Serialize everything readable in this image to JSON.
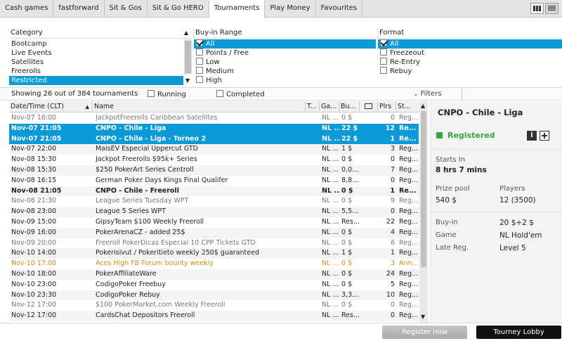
{
  "tabs": [
    {
      "label": "Cash games",
      "active": false
    },
    {
      "label": "fastforward",
      "active": false
    },
    {
      "label": "Sit & Gos",
      "active": false
    },
    {
      "label": "Sit & Go HERO",
      "active": false
    },
    {
      "label": "Tournaments",
      "active": true
    },
    {
      "label": "Play Money",
      "active": false
    },
    {
      "label": "Favourites",
      "active": false
    }
  ],
  "filters": {
    "category": {
      "header": "Category",
      "items": [
        "Bootcamp",
        "Live Events",
        "Satellites",
        "Freerolls",
        "Restricted"
      ],
      "selected_index": 4
    },
    "buyin": {
      "header": "Buy-in Range",
      "items": [
        {
          "label": "All",
          "checked": true
        },
        {
          "label": "Points / Free",
          "checked": false
        },
        {
          "label": "Low",
          "checked": false
        },
        {
          "label": "Medium",
          "checked": false
        },
        {
          "label": "High",
          "checked": false
        }
      ]
    },
    "format": {
      "header": "Format",
      "items": [
        {
          "label": "All",
          "checked": true
        },
        {
          "label": "Freezeout",
          "checked": false
        },
        {
          "label": "Re-Entry",
          "checked": false
        },
        {
          "label": "Rebuy",
          "checked": false
        }
      ]
    }
  },
  "showbar": {
    "showing": "Showing 26 out of 384 tournaments",
    "running": "Running",
    "completed": "Completed",
    "filters": "Filters"
  },
  "table": {
    "headers": [
      "Date/Time (CLT)",
      "Name",
      "T...",
      "Ga...",
      "Bu...",
      "",
      "Plrs",
      "St..."
    ],
    "rows": [
      {
        "date": "Nov-07 16:00",
        "name": "JackpotFreerolls Caribbean Satellites",
        "game": "NL ...",
        "buyin": "0 $",
        "plrs": "0",
        "status": "Reg...",
        "style": "gray"
      },
      {
        "date": "Nov-07 21:05",
        "name": "CNPO - Chile - Liga",
        "game": "NL ...",
        "buyin": "22 $",
        "plrs": "12",
        "status": "Re...",
        "style": "sel"
      },
      {
        "date": "Nov-07 21:05",
        "name": "CNPO - Chile - Liga - Torneo 2",
        "game": "NL ...",
        "buyin": "22 $",
        "plrs": "1",
        "status": "Re...",
        "style": "sel"
      },
      {
        "date": "Nov-07 22:00",
        "name": "MaisEV Especial Uppercut GTD",
        "game": "NL ...",
        "buyin": "1 $",
        "plrs": "3",
        "status": "Reg...",
        "style": ""
      },
      {
        "date": "Nov-08 15:30",
        "name": "Jackpot Freerolls $95k+ Series",
        "game": "NL ...",
        "buyin": "0 $",
        "plrs": "0",
        "status": "Reg...",
        "style": ""
      },
      {
        "date": "Nov-08 15:30",
        "name": "$250 PokerArt Series Centroll",
        "game": "NL ...",
        "buyin": "0,0...",
        "plrs": "7",
        "status": "Reg...",
        "style": ""
      },
      {
        "date": "Nov-08 16:15",
        "name": "German Poker Days Kings Final Qualifer",
        "game": "NL ...",
        "buyin": "8,8...",
        "plrs": "0",
        "status": "Reg...",
        "style": ""
      },
      {
        "date": "Nov-08 21:05",
        "name": "CNPO - Chile - Freeroll",
        "game": "NL ...",
        "buyin": "0 $",
        "plrs": "1",
        "status": "Re...",
        "style": "bold"
      },
      {
        "date": "Nov-08 21:30",
        "name": "League Series Tuesday WPT",
        "game": "NL ...",
        "buyin": "0 $",
        "plrs": "9",
        "status": "Reg...",
        "style": "gray"
      },
      {
        "date": "Nov-08 23:00",
        "name": "League 5 Series WPT",
        "game": "NL ...",
        "buyin": "5,5...",
        "plrs": "0",
        "status": "Reg...",
        "style": ""
      },
      {
        "date": "Nov-09 15:00",
        "name": "GipsyTeam $100 Weekly Freeroll",
        "game": "NL ...",
        "buyin": "Res...",
        "plrs": "22",
        "status": "Reg...",
        "style": ""
      },
      {
        "date": "Nov-09 16:00",
        "name": "PokerArenaCZ - added 25$",
        "game": "NL ...",
        "buyin": "0 $",
        "plrs": "4",
        "status": "Reg...",
        "style": ""
      },
      {
        "date": "Nov-09 20:00",
        "name": "Freeroll PokerDicas Especial 10 CPP Tickets GTD",
        "game": "NL ...",
        "buyin": "0 $",
        "plrs": "6",
        "status": "Reg...",
        "style": "gray"
      },
      {
        "date": "Nov-10 14:00",
        "name": "Pokerisivut / Pokeritieto weekly 250$ guaranteed",
        "game": "NL ...",
        "buyin": "1 $",
        "plrs": "1",
        "status": "Reg...",
        "style": ""
      },
      {
        "date": "Nov-10 17:00",
        "name": "Aces High FB Forum bounty weekly",
        "game": "NL ...",
        "buyin": "0 $",
        "plrs": "3",
        "status": "Ann...",
        "style": "orange"
      },
      {
        "date": "Nov-10 18:00",
        "name": "PokerAffiliateWare",
        "game": "NL ...",
        "buyin": "0 $",
        "plrs": "24",
        "status": "Reg...",
        "style": ""
      },
      {
        "date": "Nov-10 23:00",
        "name": "CodigoPoker Freebuy",
        "game": "NL ...",
        "buyin": "0 $",
        "plrs": "5",
        "status": "Reg...",
        "style": ""
      },
      {
        "date": "Nov-10 23:30",
        "name": "CodigoPoker Rebuy",
        "game": "NL ...",
        "buyin": "3,3...",
        "plrs": "10",
        "status": "Reg...",
        "style": ""
      },
      {
        "date": "Nov-12 17:00",
        "name": "$100 PokerMarket.com Weekly Freeroll",
        "game": "NL ...",
        "buyin": "0 $",
        "plrs": "0",
        "status": "Reg...",
        "style": "gray"
      },
      {
        "date": "Nov-12 17:00",
        "name": "CardsChat Depositors Freeroll",
        "game": "NL ...",
        "buyin": "Res...",
        "plrs": "0",
        "status": "Reg...",
        "style": ""
      }
    ]
  },
  "detail": {
    "title": "CNPO - Chile - Liga",
    "status": "Registered",
    "starts_in_label": "Starts In",
    "starts_in_value": "8 hrs  7 mins",
    "prize_pool_label": "Prize pool",
    "prize_pool_value": "540 $",
    "players_label": "Players",
    "players_value": "12 (3500)",
    "buyin_label": "Buy-in",
    "buyin_value": "20 $+2 $",
    "game_label": "Game",
    "game_value": "NL Hold'em",
    "latereg_label": "Late Reg.",
    "latereg_value": "Level 5"
  },
  "buttons": {
    "register": "Register now",
    "lobby": "Tourney Lobby"
  },
  "colors": {
    "selection": "#0a9ad8",
    "registered": "#2fa83c",
    "orange_row": "#e08a10"
  }
}
